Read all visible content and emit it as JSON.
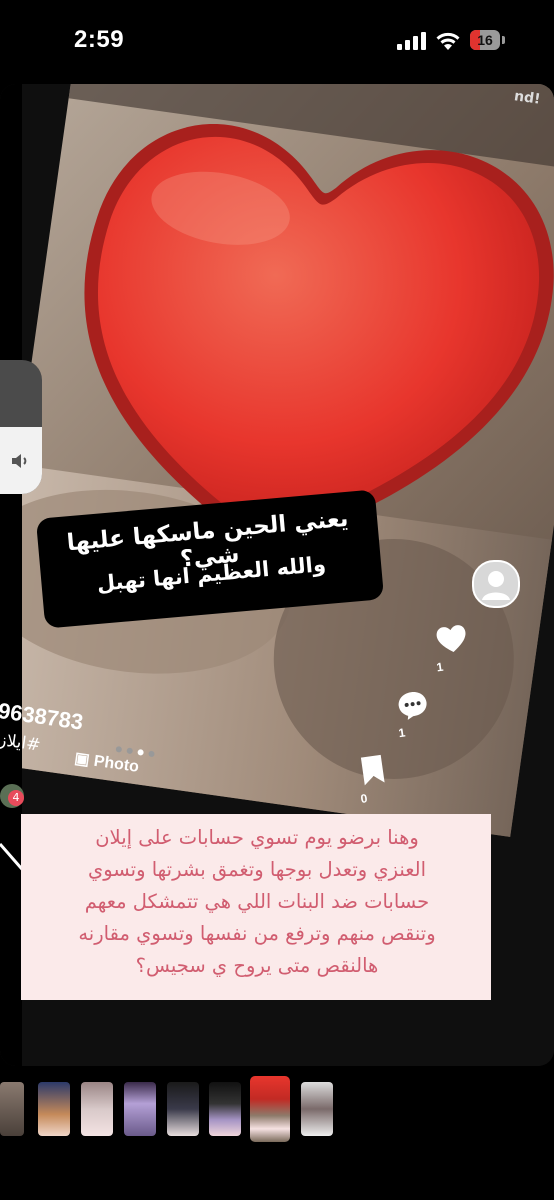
{
  "status_bar": {
    "time": "2:59",
    "battery_level": "16",
    "signal_icon": "cellular-signal-icon",
    "wifi_icon": "wifi-icon",
    "battery_icon": "battery-low-icon"
  },
  "story": {
    "caption_line1": "يعني الحين ماسكها عليها شي؟",
    "caption_line2": "والله العظيم انها تهبل",
    "likes_count": "1",
    "comments_count": "1",
    "saves_count": "0",
    "handle_partial": "9638783",
    "hashtag": "ايلاز#",
    "photo_label": "Photo",
    "notification_count": "4",
    "top_edge_text": "nd!",
    "volume_level": 0.5,
    "heart_color": "#e8362d"
  },
  "text_card": {
    "line1": "وهنا برضو يوم تسوي حسابات على إيلان",
    "line2": "العنزي وتعدل بوجها وتغمق بشرتها وتسوي",
    "line3": "حسابات ضد البنات اللي هي تتمشكل معهم",
    "line4": "وتنقص منهم وترفع من نفسها وتسوي مقارنه",
    "line5": "هالنقص متى يروح ي سجيس؟",
    "text_color": "#d15d70",
    "background": "#fbeaea"
  },
  "thumbnails": {
    "count": 10,
    "selected_index": 7
  }
}
